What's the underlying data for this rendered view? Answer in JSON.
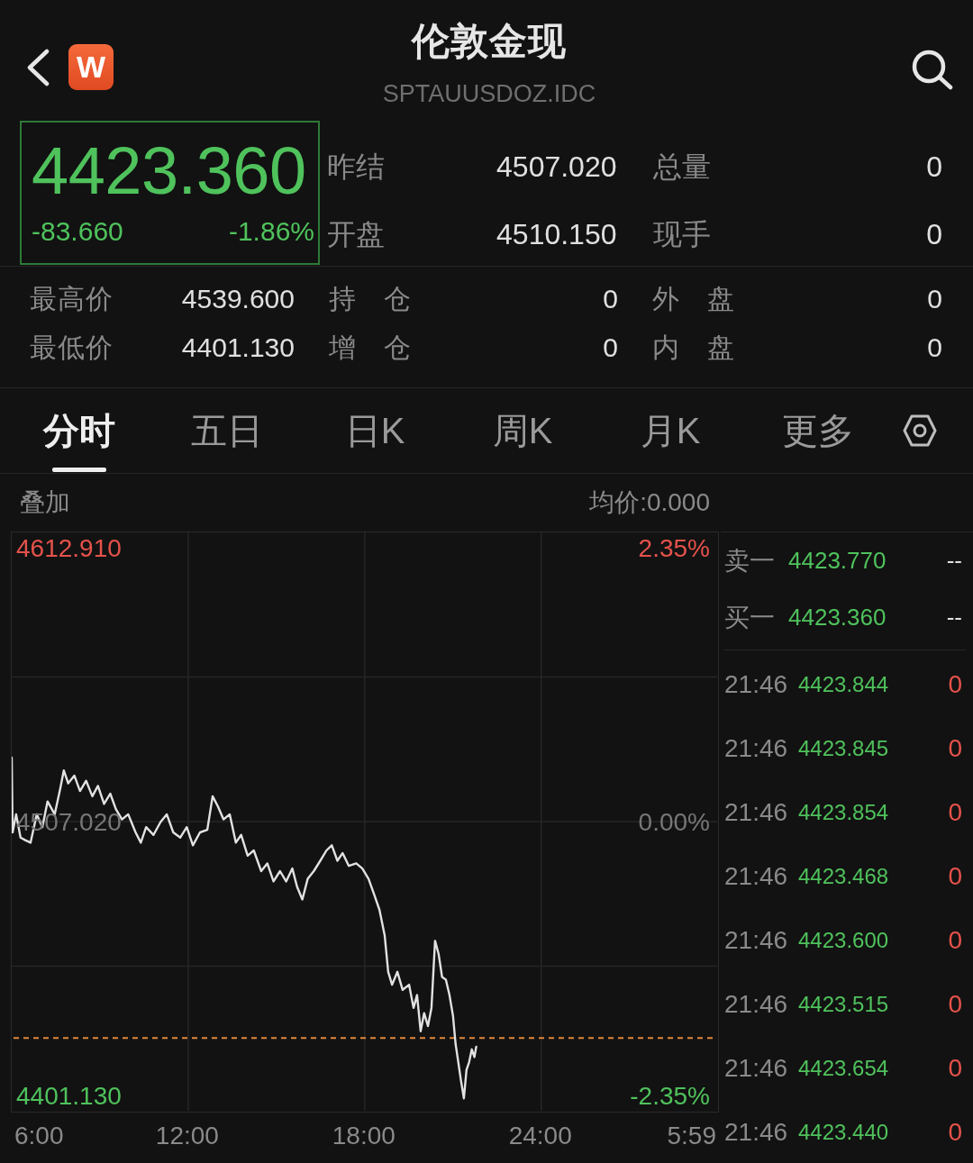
{
  "header": {
    "logo": "W",
    "title": "伦敦金现",
    "code": "SPTAUUSDOZ.IDC"
  },
  "quote": {
    "price": "4423.360",
    "change": "-83.660",
    "change_percent": "-1.86%",
    "rising": false
  },
  "stats": [
    {
      "label": "昨结",
      "value": "4507.020"
    },
    {
      "label": "总量",
      "value": "0"
    },
    {
      "label": "开盘",
      "value": "4510.150"
    },
    {
      "label": "现手",
      "value": "0"
    }
  ],
  "details": [
    {
      "label": "最高价",
      "value": "4539.600"
    },
    {
      "label": "持 仓",
      "value": "0"
    },
    {
      "label": "外 盘",
      "value": "0"
    },
    {
      "label": "最低价",
      "value": "4401.130"
    },
    {
      "label": "增 仓",
      "value": "0"
    },
    {
      "label": "内 盘",
      "value": "0"
    }
  ],
  "tabs": [
    {
      "label": "分时",
      "selected": true
    },
    {
      "label": "五日",
      "selected": false
    },
    {
      "label": "日K",
      "selected": false
    },
    {
      "label": "周K",
      "selected": false
    },
    {
      "label": "月K",
      "selected": false
    },
    {
      "label": "更多",
      "selected": false
    }
  ],
  "chart": {
    "overlay": "叠加",
    "average": "均价:0.000",
    "percent_labels": [
      {
        "text": "2.35%",
        "color": "#e5524b"
      },
      {
        "text": "0.00%",
        "color": "#777777"
      },
      {
        "text": "-2.35%",
        "color": "#4fc25c"
      }
    ],
    "end_time": "5:59",
    "chart_data": {
      "type": "line",
      "grid": true,
      "x": [
        6,
        6.03,
        6.15,
        6.3,
        6.46,
        6.64,
        6.85,
        7.04,
        7.22,
        7.46,
        7.65,
        7.77,
        7.92,
        8.13,
        8.32,
        8.53,
        8.74,
        8.93,
        9.14,
        9.35,
        9.54,
        9.75,
        9.96,
        10.21,
        10.39,
        10.57,
        10.82,
        11.06,
        11.27,
        11.49,
        11.73,
        11.95,
        12.16,
        12.4,
        12.65,
        12.83,
        13.01,
        13.2,
        13.41,
        13.62,
        13.8,
        14.02,
        14.23,
        14.48,
        14.69,
        14.9,
        15.12,
        15.33,
        15.54,
        15.7,
        15.88,
        16.06,
        16.27,
        16.49,
        16.7,
        16.88,
        17.07,
        17.25,
        17.46,
        17.71,
        17.92,
        18.13,
        18.32,
        18.5,
        18.68,
        18.8,
        18.93,
        19.11,
        19.29,
        19.51,
        19.66,
        19.78,
        19.9,
        20.02,
        20.15,
        20.27,
        20.39,
        20.51,
        20.63,
        20.76,
        20.88,
        21,
        21.09,
        21.18,
        21.27,
        21.37,
        21.46,
        21.55,
        21.64,
        21.73,
        21.79
      ],
      "series": [
        {
          "values": [
            4532,
            4503,
            4510,
            4501,
            4500,
            4499,
            4510,
            4505,
            4515,
            4510,
            4520,
            4527,
            4522,
            4525,
            4519,
            4523,
            4517,
            4521,
            4514,
            4518,
            4512,
            4508,
            4510,
            4503,
            4499,
            4505,
            4502,
            4507,
            4510,
            4503,
            4501,
            4505,
            4498,
            4503,
            4504,
            4517,
            4513,
            4508,
            4510,
            4499,
            4502,
            4494,
            4496,
            4488,
            4491,
            4484,
            4488,
            4484,
            4489,
            4482,
            4477,
            4485,
            4488,
            4492,
            4496,
            4498,
            4492,
            4495,
            4490,
            4491,
            4489,
            4485,
            4479,
            4473,
            4463,
            4449,
            4444,
            4449,
            4442,
            4444,
            4435,
            4440,
            4426,
            4433,
            4428,
            4435,
            4461,
            4456,
            4447,
            4446,
            4440,
            4432,
            4421,
            4414,
            4407,
            4400,
            4411,
            4414,
            4419,
            4416,
            4420
          ]
        }
      ],
      "xlim": [
        6,
        29.98
      ],
      "ylim": [
        4395.2,
        4619.16
      ],
      "xticks": [
        {
          "value": 6,
          "label": "6:00"
        },
        {
          "value": 12,
          "label": "12:00"
        },
        {
          "value": 18,
          "label": "18:00"
        },
        {
          "value": 24,
          "label": "24:00"
        }
      ],
      "yticks": [
        {
          "value": 4612.91,
          "label": "4612.910"
        },
        {
          "value": 4507.02,
          "label": "4507.020"
        },
        {
          "value": 4401.13,
          "label": "4401.130"
        }
      ],
      "ref_lines": [
        {
          "axis": "y",
          "value": 4423.36
        }
      ]
    }
  },
  "order_book": [
    {
      "label": "卖一",
      "price": "4423.770",
      "volume": "--"
    },
    {
      "label": "买一",
      "price": "4423.360",
      "volume": "--"
    }
  ],
  "trades": [
    {
      "time": "21:46",
      "price": "4423.844",
      "volume": "0"
    },
    {
      "time": "21:46",
      "price": "4423.845",
      "volume": "0"
    },
    {
      "time": "21:46",
      "price": "4423.854",
      "volume": "0"
    },
    {
      "time": "21:46",
      "price": "4423.468",
      "volume": "0"
    },
    {
      "time": "21:46",
      "price": "4423.600",
      "volume": "0"
    },
    {
      "time": "21:46",
      "price": "4423.515",
      "volume": "0"
    },
    {
      "time": "21:46",
      "price": "4423.654",
      "volume": "0"
    },
    {
      "time": "21:46",
      "price": "4423.440",
      "volume": "0"
    }
  ]
}
